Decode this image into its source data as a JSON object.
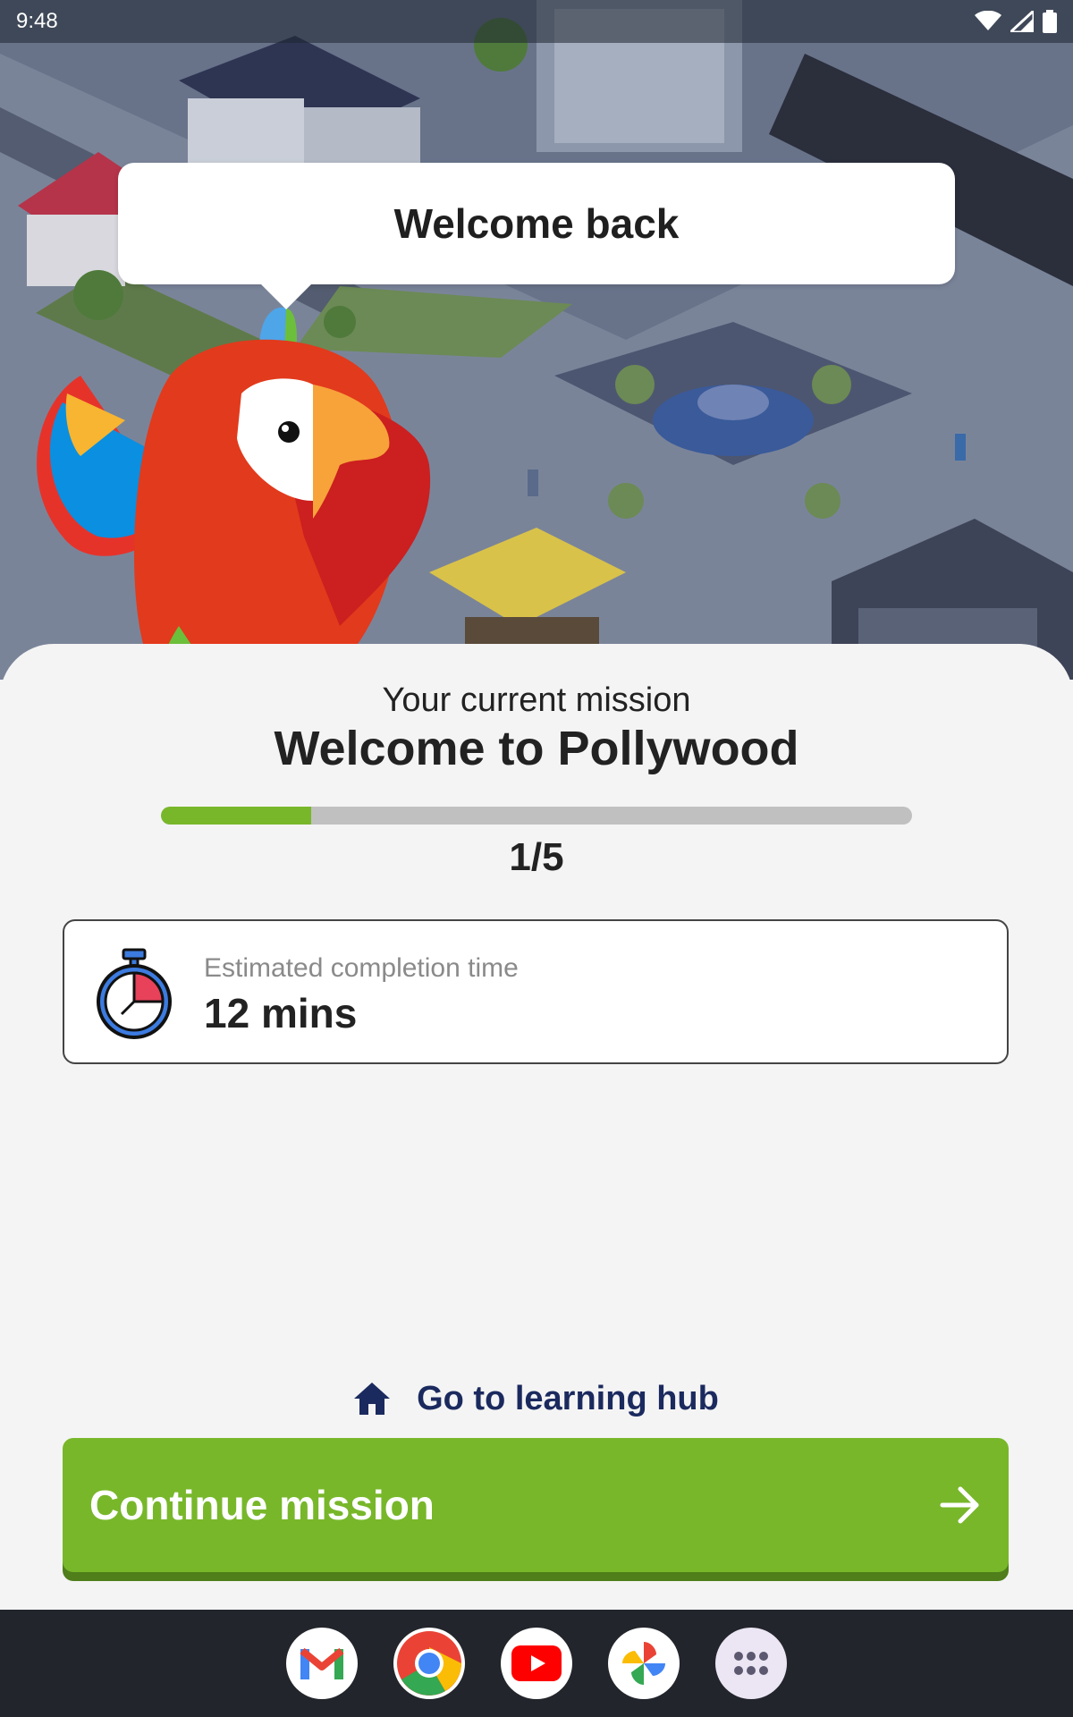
{
  "status_bar": {
    "time": "9:48",
    "icons": [
      "wifi-icon",
      "signal-icon",
      "battery-icon"
    ]
  },
  "bubble": {
    "text": "Welcome back"
  },
  "mission": {
    "label": "Your current mission",
    "title": "Welcome to Pollywood",
    "progress_current": 1,
    "progress_total": 5,
    "progress_text": "1/5"
  },
  "estimate": {
    "label": "Estimated completion time",
    "value": "12 mins",
    "icon": "stopwatch-icon"
  },
  "hub_link": {
    "label": "Go to learning hub",
    "icon": "home-icon"
  },
  "continue_button": {
    "label": "Continue mission",
    "icon": "arrow-right-icon"
  },
  "dock": {
    "apps": [
      "gmail-icon",
      "chrome-icon",
      "youtube-icon",
      "photos-icon",
      "app-drawer-icon"
    ]
  },
  "colors": {
    "accent_green": "#78b72a",
    "link_navy": "#1b2a5e",
    "progress_track": "#c0c0c0"
  }
}
